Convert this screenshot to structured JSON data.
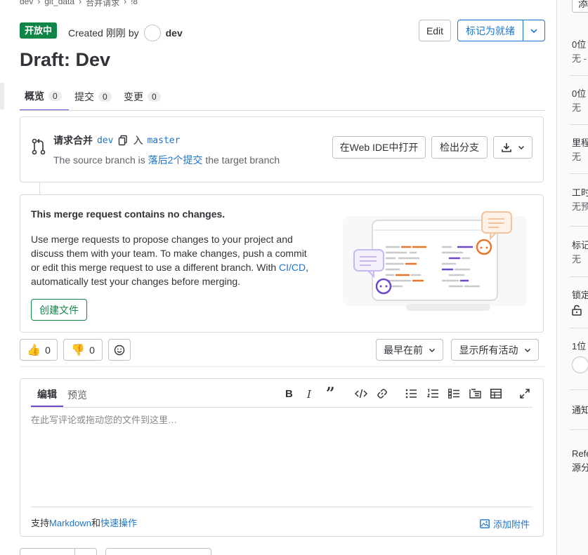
{
  "breadcrumb": [
    "dev",
    "git_data",
    "合并请求",
    "!8"
  ],
  "status_badge": "开放中",
  "created": {
    "prefix": "Created",
    "time": "刚刚",
    "by": "by",
    "author": "dev"
  },
  "header": {
    "edit": "Edit",
    "mark_ready": "标记为就绪"
  },
  "title": "Draft: Dev",
  "tabs": [
    {
      "label": "概览",
      "count": "0"
    },
    {
      "label": "提交",
      "count": "0"
    },
    {
      "label": "变更",
      "count": "0"
    }
  ],
  "widget": {
    "merge_prefix": "请求合并",
    "source": "dev",
    "into": "入",
    "target": "master",
    "line_prefix": "The source branch is",
    "line_link": "落后2个提交",
    "line_suffix": "the target branch",
    "open_ide": "在Web IDE中打开",
    "checkout": "检出分支"
  },
  "empty": {
    "heading": "This merge request contains no changes.",
    "body1": "Use merge requests to propose changes to your project and",
    "body2": "discuss them with your team. To make changes, push a commit",
    "body3": "or edit this merge request to use a different branch. With",
    "body3_link": "CI/CD",
    "body3_end": ",",
    "body4": "automatically test your changes before merging.",
    "create_file": "创建文件"
  },
  "awards": {
    "thumbs_up": "0",
    "thumbs_down": "0"
  },
  "sort": {
    "order": "最早在前",
    "filter": "显示所有活动"
  },
  "editor": {
    "tab_edit": "编辑",
    "tab_preview": "预览",
    "placeholder": "在此写评论或拖动您的文件到这里…",
    "support_prefix": "支持",
    "markdown": "Markdown",
    "and": "和",
    "quick_actions": "快速操作",
    "attach": "添加附件"
  },
  "right_sidebar": {
    "top_button": "添加",
    "assignee_title": "0位",
    "assignee_value": "无 -",
    "reviewer_title": "0位",
    "reviewer_value": "无",
    "milestone_title": "里程",
    "milestone_value": "无",
    "time_title": "工时",
    "time_value": "无预",
    "labels_title": "标记",
    "labels_value": "无",
    "lock_title": "锁定",
    "participants_title": "1位",
    "notify_title": "通知",
    "ref_title": "Refe",
    "ref_value": "源分"
  },
  "colors": {
    "accent": "#1f75cb",
    "success": "#108548",
    "draft_purple": "#6e49cb",
    "orange": "#e9772a"
  }
}
